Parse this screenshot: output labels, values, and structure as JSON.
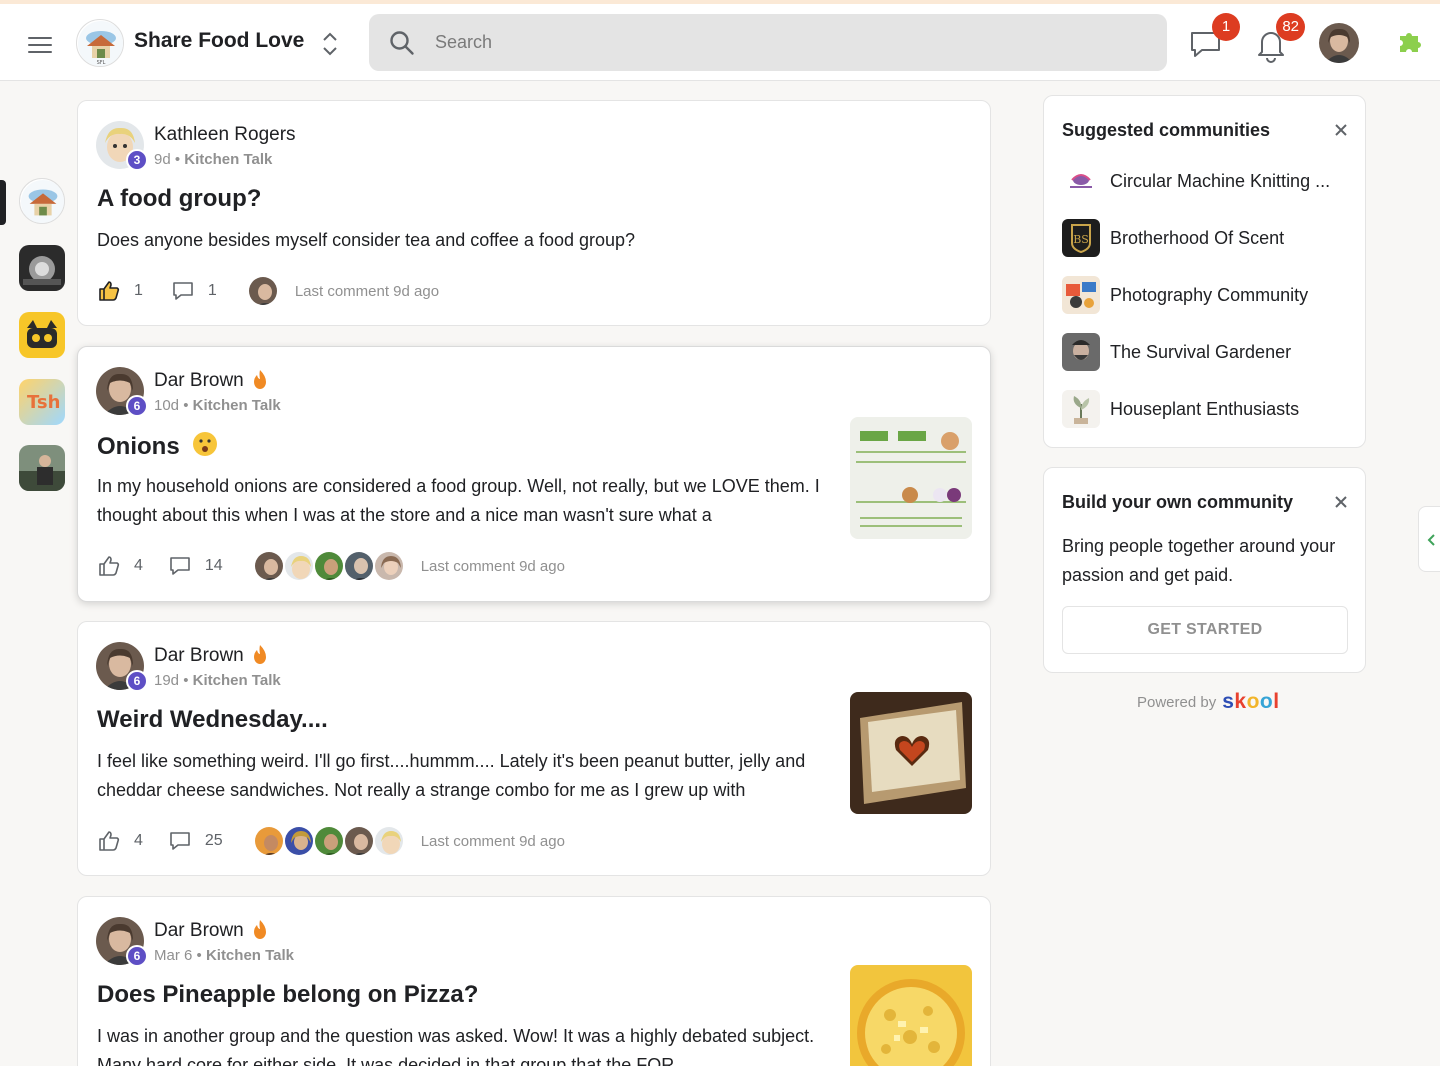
{
  "header": {
    "group_title": "Share Food Love",
    "search_placeholder": "Search",
    "chat_badge": "1",
    "notifications_badge": "82"
  },
  "rail": [
    "share-food-love",
    "community-2",
    "community-3",
    "tsh",
    "community-5"
  ],
  "posts": [
    {
      "author": "Kathleen Rogers",
      "level": "3",
      "time": "9d",
      "category": "Kitchen Talk",
      "title": "A food group?",
      "body": "Does anyone besides myself consider tea and coffee a food group?",
      "likes": "1",
      "comments": "1",
      "last_comment": "Last comment 9d ago"
    },
    {
      "author": "Dar Brown",
      "level": "6",
      "time": "10d",
      "category": "Kitchen Talk",
      "title": "Onions",
      "body": "In my household onions are considered a food group. Well, not really, but we LOVE them. I thought about this when I was at the store and a nice man wasn't sure what a",
      "likes": "4",
      "comments": "14",
      "last_comment": "Last comment 9d ago"
    },
    {
      "author": "Dar Brown",
      "level": "6",
      "time": "19d",
      "category": "Kitchen Talk",
      "title": "Weird Wednesday....",
      "body": "I feel like something weird. I'll go first....hummm.... Lately it's been peanut butter, jelly and cheddar cheese sandwiches. Not really a strange combo for me as I grew up with",
      "likes": "4",
      "comments": "25",
      "last_comment": "Last comment 9d ago"
    },
    {
      "author": "Dar Brown",
      "level": "6",
      "time": "Mar 6",
      "category": "Kitchen Talk",
      "title": "Does Pineapple belong on Pizza?",
      "body": "I was in another group and the question was asked. Wow! It was a highly debated subject. Many hard core for either side. It was decided in that group that the FOR"
    }
  ],
  "meta_separator": " • ",
  "suggested": {
    "title": "Suggested communities",
    "items": [
      "Circular Machine Knitting ...",
      "Brotherhood Of Scent",
      "Photography Community",
      "The Survival Gardener",
      "Houseplant Enthusiasts"
    ]
  },
  "build": {
    "title": "Build your own community",
    "text": "Bring people together around your passion and get paid.",
    "button": "GET STARTED"
  },
  "powered": {
    "label": "Powered by",
    "s": "s",
    "k": "k",
    "o1": "o",
    "o2": "o",
    "l": "l"
  },
  "colors": {
    "accent_level": "#5e4fc5",
    "badge_red": "#dd3c21"
  }
}
